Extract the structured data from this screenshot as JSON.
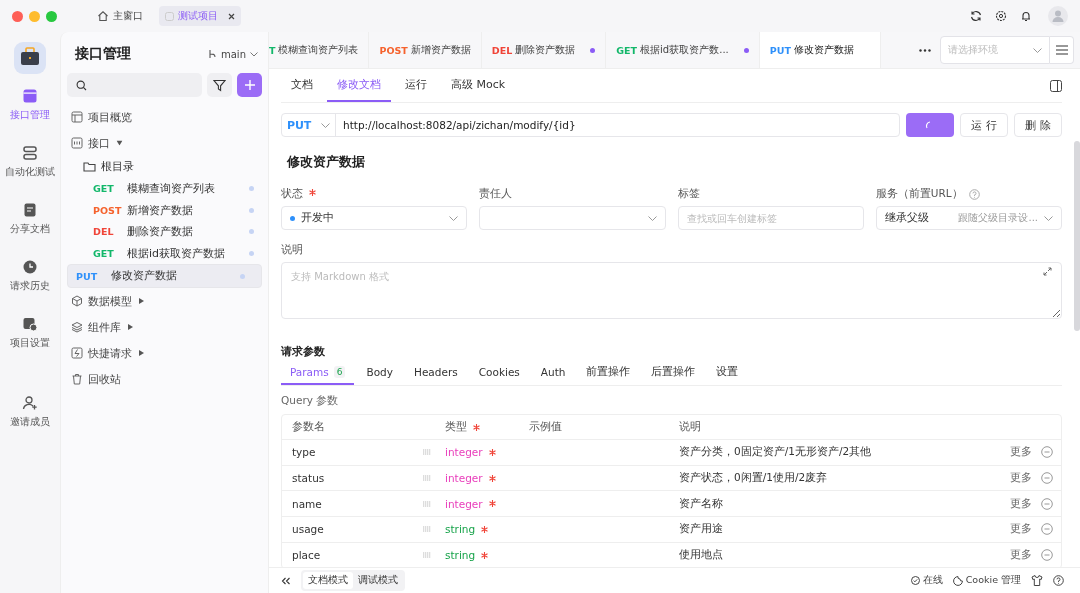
{
  "titlebar": {
    "home_tab": "主窗口",
    "project_tab": {
      "label": "测试项目",
      "selected": true
    }
  },
  "rail": [
    {
      "label": "接口管理",
      "selected": true
    },
    {
      "label": "自动化测试",
      "selected": false
    },
    {
      "label": "分享文档",
      "selected": false
    },
    {
      "label": "请求历史",
      "selected": false
    },
    {
      "label": "项目设置",
      "selected": false
    },
    {
      "label": "邀请成员",
      "selected": false
    }
  ],
  "sidebar": {
    "title": "接口管理",
    "branch": "main",
    "tree": [
      {
        "label": "项目概览"
      },
      {
        "label": "接口",
        "expanded": true,
        "children": [
          {
            "label": "根目录",
            "children": [
              {
                "method": "GET",
                "color": "#12b76a",
                "label": "模糊查询资产列表",
                "selected": false
              },
              {
                "method": "POST",
                "color": "#f5622d",
                "label": "新增资产数据",
                "selected": false
              },
              {
                "method": "DEL",
                "color": "#f04438",
                "label": "删除资产数据",
                "selected": false
              },
              {
                "method": "GET",
                "color": "#12b76a",
                "label": "根据id获取资产数据",
                "selected": false
              },
              {
                "method": "PUT",
                "color": "#2e90fa",
                "label": "修改资产数据",
                "selected": true
              }
            ]
          }
        ]
      },
      {
        "label": "数据模型",
        "expanded": false
      },
      {
        "label": "组件库",
        "expanded": false
      },
      {
        "label": "快捷请求",
        "expanded": false
      },
      {
        "label": "回收站"
      }
    ]
  },
  "editor_tabs": [
    {
      "method": "T",
      "color": "#12b76a",
      "label": "模糊查询资产列表",
      "modified": false,
      "selected": false
    },
    {
      "method": "POST",
      "color": "#f5622d",
      "label": "新增资产数据",
      "modified": false,
      "selected": false
    },
    {
      "method": "DEL",
      "color": "#f04438",
      "label": "删除资产数据",
      "modified": true,
      "selected": false
    },
    {
      "method": "GET",
      "color": "#12b76a",
      "label": "根据id获取资产数...",
      "modified": true,
      "selected": false
    },
    {
      "method": "PUT",
      "color": "#2e90fa",
      "label": "修改资产数据",
      "modified": false,
      "selected": true
    }
  ],
  "env_select": {
    "placeholder": "请选择环境"
  },
  "doc_tabs": [
    {
      "label": "文档",
      "selected": false
    },
    {
      "label": "修改文档",
      "selected": true
    },
    {
      "label": "运行",
      "selected": false
    },
    {
      "label": "高级 Mock",
      "selected": false
    }
  ],
  "request": {
    "method": "PUT",
    "url": "http://localhost:8082/api/zichan/modify/{id}",
    "run_button": "运 行",
    "delete_button": "删 除"
  },
  "api_title": "修改资产数据",
  "fields": {
    "status": {
      "label": "状态",
      "required": true,
      "value": "开发中",
      "color": "#2e90fa"
    },
    "owner": {
      "label": "责任人"
    },
    "tags": {
      "label": "标签",
      "placeholder": "查找或回车创建标签"
    },
    "service": {
      "label": "服务（前置URL）",
      "value": "继承父级",
      "hint": "跟随父级目录设..."
    },
    "description": {
      "label": "说明",
      "placeholder": "支持 Markdown 格式"
    }
  },
  "params_heading": "请求参数",
  "param_tabs": [
    {
      "label": "Params",
      "badge": "6",
      "selected": true
    },
    {
      "label": "Body",
      "selected": false
    },
    {
      "label": "Headers",
      "selected": false
    },
    {
      "label": "Cookies",
      "selected": false
    },
    {
      "label": "Auth",
      "selected": false
    },
    {
      "label": "前置操作",
      "selected": false
    },
    {
      "label": "后置操作",
      "selected": false
    },
    {
      "label": "设置",
      "selected": false
    }
  ],
  "query_label": "Query 参数",
  "table": {
    "columns": [
      {
        "label": "参数名"
      },
      {
        "label": "类型",
        "required": true
      },
      {
        "label": "示例值"
      },
      {
        "label": "说明"
      }
    ],
    "rows": [
      {
        "name": "type",
        "type": "integer",
        "color": "#e93dbb",
        "required": true,
        "description": "资产分类，0固定资产/1无形资产/2其他",
        "more": "更多"
      },
      {
        "name": "status",
        "type": "integer",
        "color": "#e93dbb",
        "required": true,
        "description": "资产状态，0闲置/1使用/2废弃",
        "more": "更多"
      },
      {
        "name": "name",
        "type": "integer",
        "color": "#e93dbb",
        "required": true,
        "description": "资产名称",
        "more": "更多"
      },
      {
        "name": "usage",
        "type": "string",
        "color": "#17a34a",
        "required": true,
        "description": "资产用途",
        "more": "更多"
      },
      {
        "name": "place",
        "type": "string",
        "color": "#17a34a",
        "required": true,
        "description": "使用地点",
        "more": "更多"
      }
    ]
  },
  "bottom_bar": {
    "modes": [
      {
        "label": "文档模式",
        "selected": true
      },
      {
        "label": "调试模式",
        "selected": false
      }
    ],
    "online": "在线",
    "cookie": "Cookie 管理"
  }
}
